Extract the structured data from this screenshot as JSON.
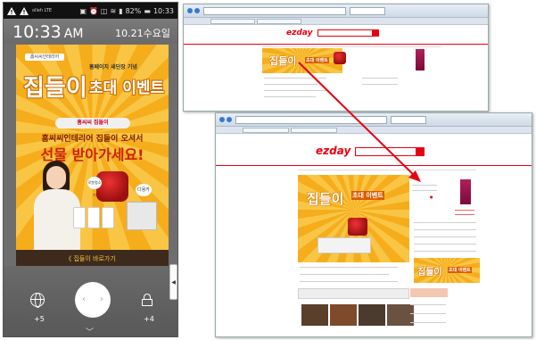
{
  "phone": {
    "status": {
      "carrier": "olleh LTE",
      "battery": "82%",
      "clock": "10:33"
    },
    "lockscreen": {
      "time": "10:33",
      "time_ampm": "AM",
      "date": "10.21수요일",
      "left_count": "+5",
      "right_count": "+4"
    },
    "ad": {
      "brand": "홈씨씨인테리어",
      "subtitle": "홈페이지 새단장 기념",
      "title_main": "집들이",
      "title_sub": "초대 이벤트",
      "banner": "홈씨씨 집들이",
      "message1": "홈씨씨인테리어 집들이 오셔서",
      "message2": "선물 받아가세요!",
      "tag_left": "로봇청소기",
      "tag_right": "다용카",
      "cta": "《 집들이 바로가기"
    },
    "side_tab": "◀"
  },
  "browser_back": {
    "logo": "ezday",
    "ad_title_main": "집들이",
    "ad_title_sub": "초대 이벤트"
  },
  "browser_front": {
    "logo": "ezday",
    "ad_title_main": "집들이",
    "ad_title_sub": "초대 이벤트",
    "ad2_title_main": "집들이",
    "ad2_title_sub": "초대 이벤트"
  },
  "colors": {
    "accent": "#e60012",
    "ad_orange": "#f7b628",
    "arrow": "#e60012"
  },
  "icons": [
    "warning-icon",
    "globe-icon",
    "lock-icon",
    "search-icon",
    "chevron-up-icon",
    "chevron-down-icon"
  ]
}
